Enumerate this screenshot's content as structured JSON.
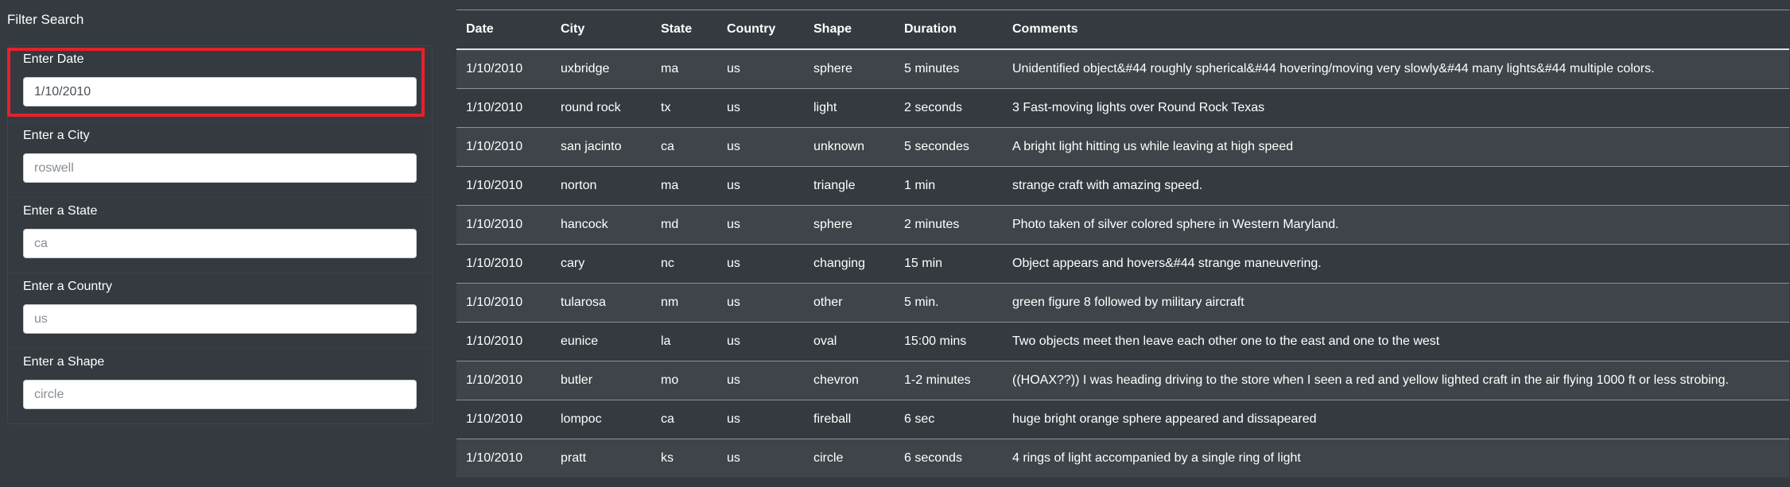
{
  "sidebar": {
    "title": "Filter Search",
    "filters": [
      {
        "label": "Enter Date",
        "value": "1/10/2010",
        "placeholder": ""
      },
      {
        "label": "Enter a City",
        "value": "",
        "placeholder": "roswell"
      },
      {
        "label": "Enter a State",
        "value": "",
        "placeholder": "ca"
      },
      {
        "label": "Enter a Country",
        "value": "",
        "placeholder": "us"
      },
      {
        "label": "Enter a Shape",
        "value": "",
        "placeholder": "circle"
      }
    ]
  },
  "highlight_color": "#e5212a",
  "table": {
    "headers": [
      "Date",
      "City",
      "State",
      "Country",
      "Shape",
      "Duration",
      "Comments"
    ],
    "rows": [
      [
        "1/10/2010",
        "uxbridge",
        "ma",
        "us",
        "sphere",
        "5 minutes",
        "Unidentified object&#44 roughly spherical&#44 hovering/moving very slowly&#44 many lights&#44 multiple colors."
      ],
      [
        "1/10/2010",
        "round rock",
        "tx",
        "us",
        "light",
        "2 seconds",
        "3 Fast-moving lights over Round Rock Texas"
      ],
      [
        "1/10/2010",
        "san jacinto",
        "ca",
        "us",
        "unknown",
        "5 secondes",
        "A bright light hitting us while leaving at high speed"
      ],
      [
        "1/10/2010",
        "norton",
        "ma",
        "us",
        "triangle",
        "1 min",
        "strange craft with amazing speed."
      ],
      [
        "1/10/2010",
        "hancock",
        "md",
        "us",
        "sphere",
        "2 minutes",
        "Photo taken of silver colored sphere in Western Maryland."
      ],
      [
        "1/10/2010",
        "cary",
        "nc",
        "us",
        "changing",
        "15 min",
        "Object appears and hovers&#44 strange maneuvering."
      ],
      [
        "1/10/2010",
        "tularosa",
        "nm",
        "us",
        "other",
        "5 min.",
        "green figure 8 followed by military aircraft"
      ],
      [
        "1/10/2010",
        "eunice",
        "la",
        "us",
        "oval",
        "15:00 mins",
        "Two objects meet then leave each other one to the east and one to the west"
      ],
      [
        "1/10/2010",
        "butler",
        "mo",
        "us",
        "chevron",
        "1-2 minutes",
        "((HOAX??)) I was heading driving to the store when I seen a red and yellow lighted craft in the air flying 1000 ft or less strobing."
      ],
      [
        "1/10/2010",
        "lompoc",
        "ca",
        "us",
        "fireball",
        "6 sec",
        "huge bright orange sphere appeared and dissapeared"
      ],
      [
        "1/10/2010",
        "pratt",
        "ks",
        "us",
        "circle",
        "6 seconds",
        "4 rings of light accompanied by a single ring of light"
      ]
    ]
  }
}
